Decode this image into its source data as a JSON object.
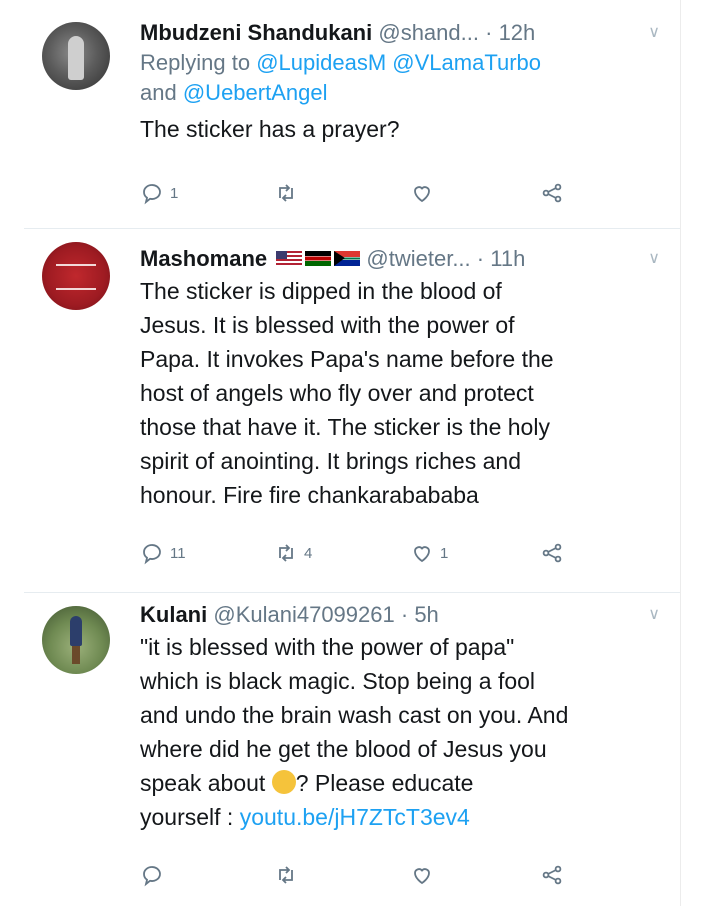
{
  "tweets": [
    {
      "name": "Mbudzeni Shandukani",
      "handle": "@shand...",
      "time": "12h",
      "replying_label": "Replying to",
      "mentions": [
        "@LupideasM",
        "@VLamaTurbo",
        "@UebertAngel"
      ],
      "and_label": "and",
      "text": "The sticker has a prayer?",
      "replies": "1",
      "retweets": "",
      "likes": ""
    },
    {
      "name": "Mashomane",
      "flags": [
        "flag-us-icon",
        "flag-kenya-icon",
        "flag-south-africa-icon"
      ],
      "handle": "@twieter...",
      "time": "11h",
      "lines": [
        "The sticker is dipped in the blood of",
        "Jesus. It is blessed with the power of",
        "Papa. It invokes Papa's name before the",
        "host of angels who fly over and protect",
        "those that have it. The sticker is the holy",
        "spirit of anointing. It brings riches and",
        "honour. Fire fire chankarabababa"
      ],
      "replies": "11",
      "retweets": "4",
      "likes": "1"
    },
    {
      "name": "Kulani",
      "handle": "@Kulani47099261",
      "time": "5h",
      "lines": [
        "\"it is blessed with the power of papa\"",
        "which is black magic. Stop being a fool",
        "and undo the brain wash cast on you. And",
        "where did he get the blood of Jesus you"
      ],
      "line5_pre": "speak about",
      "line5_post": "? Please educate",
      "line6_pre": "yourself :",
      "link": "youtu.be/jH7ZTcT3ev4",
      "replies": "",
      "retweets": "",
      "likes": ""
    }
  ],
  "dot": "·",
  "colors": {
    "link": "#1da1f2",
    "muted": "#657786"
  }
}
